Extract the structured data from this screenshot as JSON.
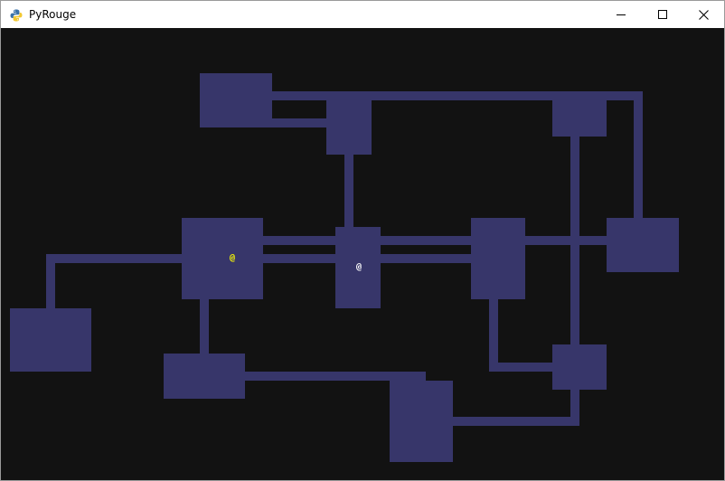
{
  "window": {
    "title": "PyRouge"
  },
  "colors": {
    "floor": "#37366a",
    "void": "#121212",
    "player": "#ffff00",
    "npc": "#ffffff"
  },
  "entities": [
    {
      "name": "player",
      "char": "@",
      "color": "#ffff00"
    },
    {
      "name": "npc",
      "char": "@",
      "color": "#ffffff"
    }
  ]
}
